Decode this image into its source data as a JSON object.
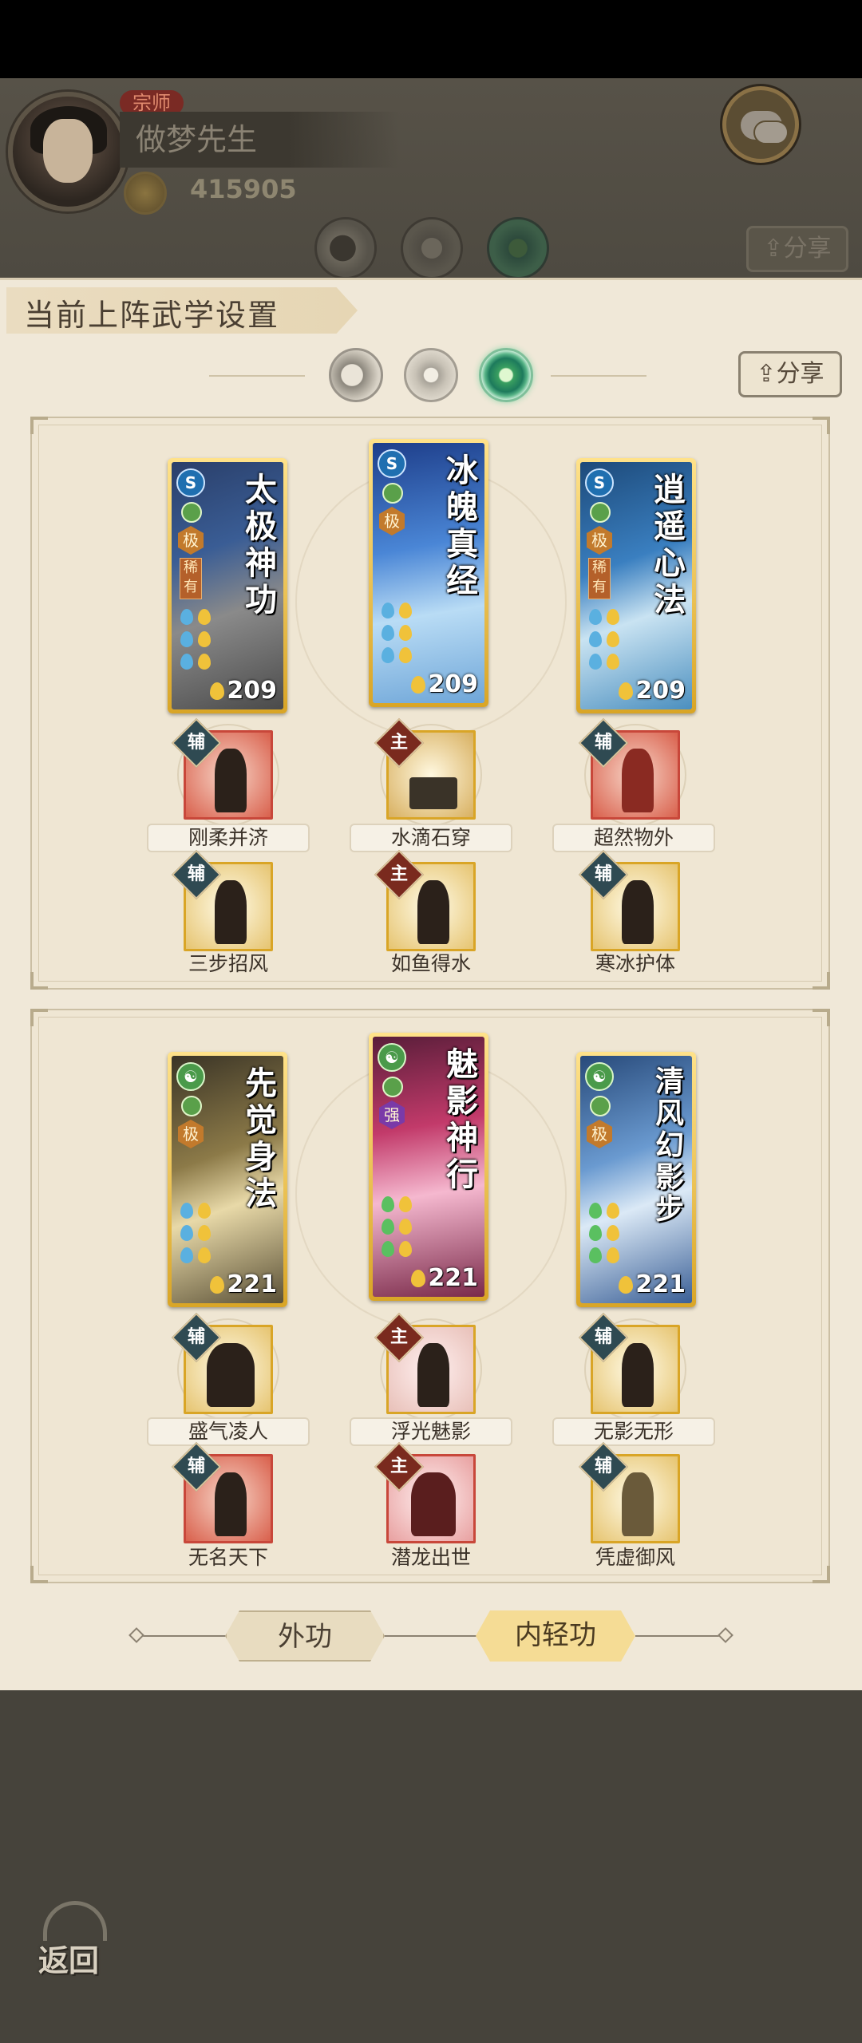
{
  "header": {
    "rank_badge": "宗师",
    "player_name": "做梦先生",
    "coin_value": "415905",
    "share_label": "分享"
  },
  "panel": {
    "title": "当前上阵武学设置",
    "share_label": "分享"
  },
  "section1": {
    "cards": [
      {
        "title": "太极神功",
        "grade": "极",
        "rarity": "稀有",
        "level": "209"
      },
      {
        "title": "冰魄真经",
        "grade": "极",
        "rarity": "",
        "level": "209"
      },
      {
        "title": "逍遥心法",
        "grade": "极",
        "rarity": "稀有",
        "level": "209"
      }
    ],
    "skills_row1": [
      {
        "tag": "辅",
        "label": "刚柔并济"
      },
      {
        "tag": "主",
        "label": "水滴石穿"
      },
      {
        "tag": "辅",
        "label": "超然物外"
      }
    ],
    "skills_row2": [
      {
        "tag": "辅",
        "label": "三步招风"
      },
      {
        "tag": "主",
        "label": "如鱼得水"
      },
      {
        "tag": "辅",
        "label": "寒冰护体"
      }
    ]
  },
  "section2": {
    "cards": [
      {
        "title": "先觉身法",
        "grade": "极",
        "level": "221"
      },
      {
        "title": "魅影神行",
        "grade": "强",
        "level": "221"
      },
      {
        "title": "清风幻影步",
        "grade": "极",
        "level": "221"
      }
    ],
    "skills_row1": [
      {
        "tag": "辅",
        "label": "盛气凌人"
      },
      {
        "tag": "主",
        "label": "浮光魅影"
      },
      {
        "tag": "辅",
        "label": "无影无形"
      }
    ],
    "skills_row2": [
      {
        "tag": "辅",
        "label": "无名天下"
      },
      {
        "tag": "主",
        "label": "潜龙出世"
      },
      {
        "tag": "辅",
        "label": "凭虚御风"
      }
    ]
  },
  "bottom_tabs": {
    "external": "外功",
    "internal": "内轻功"
  },
  "back_label": "返回",
  "colors": {
    "panel_bg": "#f0e8d8",
    "gold": "#d9a526",
    "main_tag": "#7a2a1e",
    "assist_tag": "#2f4a52"
  }
}
